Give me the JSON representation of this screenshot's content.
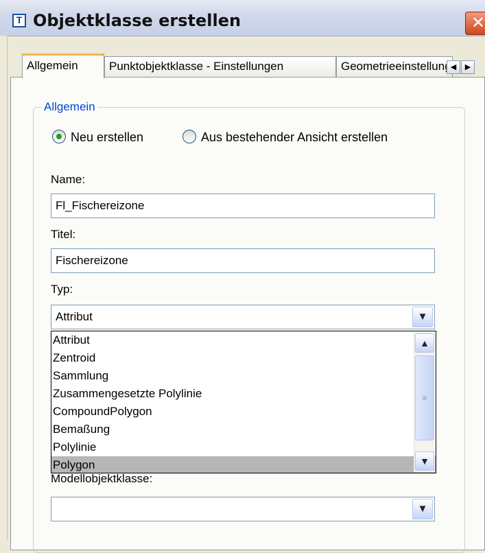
{
  "window": {
    "app_icon": "T",
    "title": "Objektklasse erstellen",
    "close_glyph": "✕"
  },
  "tabs": [
    {
      "label": "Allgemein",
      "active": true
    },
    {
      "label": "Punktobjektklasse - Einstellungen",
      "active": false
    },
    {
      "label": "Geometrieeinstellungen",
      "active": false
    }
  ],
  "tab_scroll": {
    "left": "◀",
    "right": "▶"
  },
  "group": {
    "title": "Allgemein",
    "radio_new": "Neu erstellen",
    "radio_existing": "Aus bestehender Ansicht erstellen",
    "selected_radio": "Neu erstellen"
  },
  "fields": {
    "name_label": "Name:",
    "name_value": "Fl_Fischereizone",
    "title_label": "Titel:",
    "title_value": "Fischereizone",
    "type_label": "Typ:",
    "type_value": "Attribut",
    "model_label": "Modellobjektklasse:",
    "model_value": ""
  },
  "type_options": [
    "Attribut",
    "Zentroid",
    "Sammlung",
    "Zusammengesetzte Polylinie",
    "CompoundPolygon",
    "Bemaßung",
    "Polylinie",
    "Polygon"
  ],
  "highlighted_option": "Polygon",
  "icons": {
    "combo_arrow": "chevron-down-icon",
    "scroll_up": "chevron-up-icon",
    "scroll_down": "chevron-down-icon",
    "grip": "grip-icon"
  },
  "colors": {
    "legend": "#0046d5",
    "active_tab_accent": "#f4b34a",
    "close_button": "#d2451f",
    "radio_dot": "#21a121",
    "highlight": "#b6b6b6"
  }
}
